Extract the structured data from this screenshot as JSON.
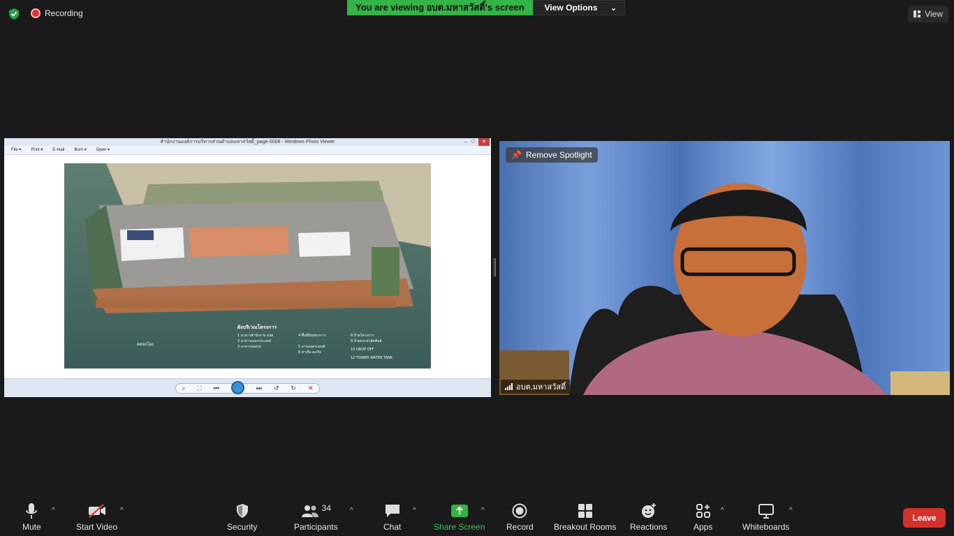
{
  "topbar": {
    "recording_label": "Recording",
    "viewing_label": "You are viewing อบต.มหาสวัสดิ์'s screen",
    "view_options_label": "View Options",
    "view_label": "View"
  },
  "shared_window": {
    "title": "สำนักงานองค์การบริหารส่วนตำบลมหาสวัสดิ์_page-0006 - Windows Photo Viewer",
    "menu": [
      "File ▾",
      "Print ▾",
      "E-mail",
      "Burn ▾",
      "Open ▾"
    ],
    "legend_title": "ผังบริเวณโครงการ",
    "legend_items": [
      "1 อาคารสำนักงาน อบต.",
      "2 อาคารเอนกประสงค์",
      "3 อาคารจอดรถ",
      "4 พื้นที่นันทนาการ",
      "5 ลานจอดรถยนต์",
      "6 ท่าเรือ-ลงเรือ",
      "8 ป้ายโครงการ",
      "9 ป้ายประชาสัมพันธ์",
      "10 DROP OFF",
      "12 TOWER WATER TANK"
    ],
    "canal_label": "คลองโยง"
  },
  "video": {
    "remove_spotlight_label": "Remove Spotlight",
    "participant_name": "อบต.มหาสวัสดิ์"
  },
  "toolbar": {
    "mute": "Mute",
    "start_video": "Start Video",
    "security": "Security",
    "participants": "Participants",
    "participants_count": "34",
    "chat": "Chat",
    "share_screen": "Share Screen",
    "record": "Record",
    "breakout_rooms": "Breakout Rooms",
    "reactions": "Reactions",
    "apps": "Apps",
    "whiteboards": "Whiteboards",
    "leave": "Leave"
  },
  "colors": {
    "accent_green": "#34b347",
    "leave_red": "#d3312b",
    "background": "#1a1a1a"
  }
}
